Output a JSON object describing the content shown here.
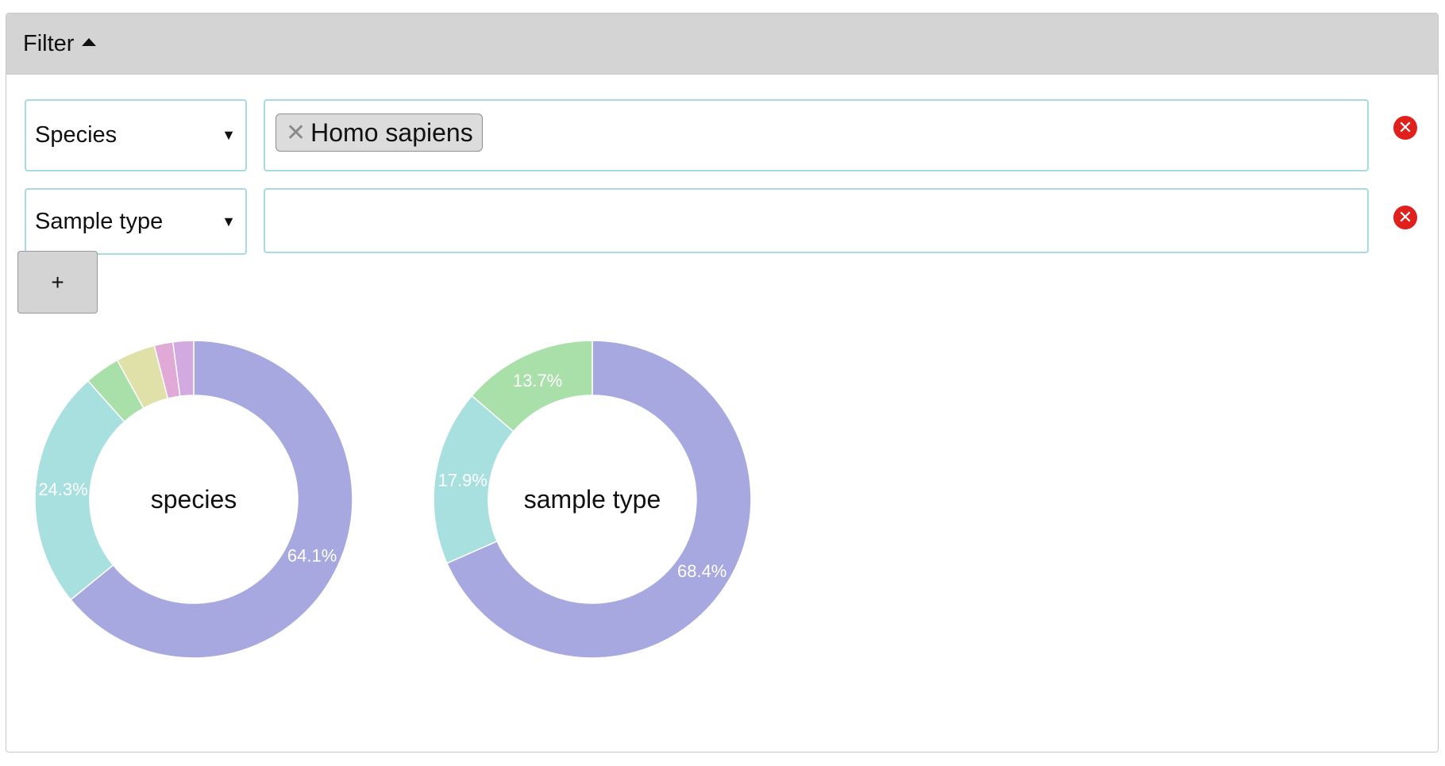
{
  "filter": {
    "title": "Filter",
    "toggle_icon": "caret-up-icon",
    "rows": [
      {
        "field": "Species",
        "tags": [
          "Homo sapiens"
        ]
      },
      {
        "field": "Sample type",
        "tags": []
      }
    ],
    "remove_icon": "remove-circle-icon",
    "add_label": "+"
  },
  "colors": {
    "header_bg": "#d4d4d4",
    "input_border": "#a9d9e5",
    "remove_red": "#e0201c"
  },
  "chart_data": [
    {
      "type": "pie",
      "donut": true,
      "center_label": "species",
      "values": [
        64.1,
        24.3,
        3.6,
        4.0,
        1.9,
        2.1
      ],
      "labels": [
        "64.1%",
        "24.3%",
        "",
        "",
        "",
        ""
      ],
      "colors": [
        "#a8a8e0",
        "#a8e0e0",
        "#a9e0a9",
        "#e0e0a9",
        "#e0a9d6",
        "#d2a9e0"
      ]
    },
    {
      "type": "pie",
      "donut": true,
      "center_label": "sample type",
      "values": [
        68.4,
        17.9,
        13.7
      ],
      "labels": [
        "68.4%",
        "17.9%",
        "13.7%"
      ],
      "colors": [
        "#a8a8e0",
        "#a8e0e0",
        "#a9e0a9"
      ]
    }
  ]
}
